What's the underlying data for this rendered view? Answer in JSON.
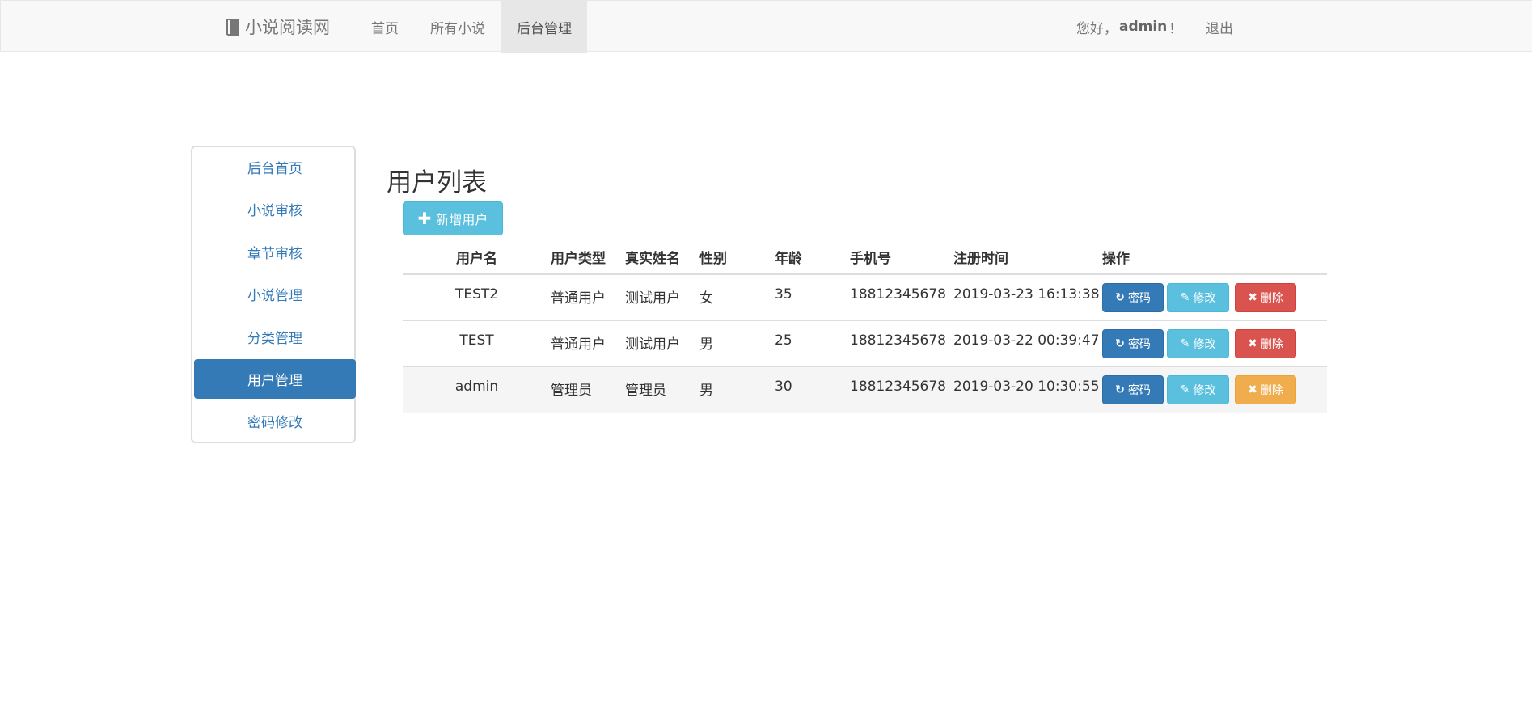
{
  "navbar": {
    "brand": "小说阅读网",
    "brand_icon": "book-icon",
    "links": [
      {
        "label": "首页"
      },
      {
        "label": "所有小说"
      },
      {
        "label": "后台管理",
        "active": true
      }
    ],
    "greeting_prefix": "您好，",
    "user": "admin",
    "greeting_suffix": "！",
    "logout": "退出"
  },
  "sidebar": {
    "items": [
      {
        "label": "后台首页"
      },
      {
        "label": "小说审核"
      },
      {
        "label": "章节审核"
      },
      {
        "label": "小说管理"
      },
      {
        "label": "分类管理"
      },
      {
        "label": "用户管理",
        "active": true
      },
      {
        "label": "密码修改"
      }
    ]
  },
  "main": {
    "title": "用户列表",
    "add_button": "新增用户",
    "table": {
      "headers": [
        "用户名",
        "用户类型",
        "真实姓名",
        "性别",
        "年龄",
        "手机号",
        "注册时间",
        "操作"
      ],
      "rows": [
        {
          "username": "TEST2",
          "type": "普通用户",
          "real_name": "测试用户",
          "sex": "女",
          "age": "35",
          "phone": "18812345678",
          "registered": "2019-03-23 16:13:38"
        },
        {
          "username": "TEST",
          "type": "普通用户",
          "real_name": "测试用户",
          "sex": "男",
          "age": "25",
          "phone": "18812345678",
          "registered": "2019-03-22 00:39:47"
        },
        {
          "username": "admin",
          "type": "管理员",
          "real_name": "管理员",
          "sex": "男",
          "age": "30",
          "phone": "18812345678",
          "registered": "2019-03-20 10:30:55"
        }
      ],
      "actions": {
        "password": "密码",
        "edit": "修改",
        "delete": "删除"
      }
    }
  },
  "colors": {
    "primary": "#337ab7",
    "info": "#5bc0de",
    "danger": "#d9534f",
    "warning": "#f0ad4e"
  }
}
